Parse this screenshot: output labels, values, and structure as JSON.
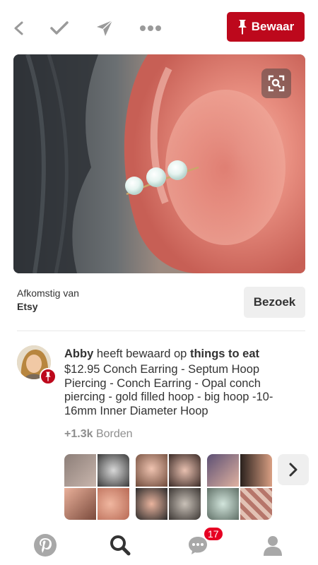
{
  "toolbar": {
    "back_icon": "chevron-left-icon",
    "done_icon": "checkmark-icon",
    "send_icon": "send-icon",
    "more_icon": "more-dots-icon",
    "save_label": "Bewaar"
  },
  "pin": {
    "image_description_icon": "visual-search-icon"
  },
  "source": {
    "label": "Afkomstig van",
    "name": "Etsy",
    "visit_label": "Bezoek"
  },
  "activity": {
    "user": "Abby",
    "action": "heeft bewaard op",
    "board": "things to eat",
    "description": "$12.95 Conch Earring - Septum Hoop Piercing - Conch Earring - Opal conch piercing - gold filled hoop - big hoop -10-16mm Inner Diameter Hoop",
    "board_count": "+1.3k",
    "board_count_label": "Borden"
  },
  "bottom_nav": {
    "items": [
      "home-icon",
      "search-icon",
      "messages-icon",
      "profile-icon"
    ],
    "notification_count": "17"
  },
  "colors": {
    "accent": "#bd081c",
    "button_gray": "#efefef",
    "muted_text": "#8e8e8e"
  }
}
